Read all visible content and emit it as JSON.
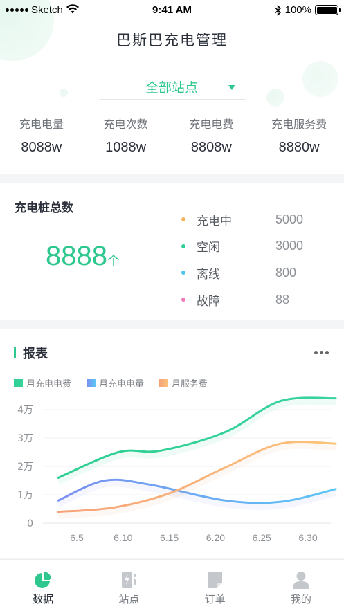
{
  "status_bar": {
    "carrier": "Sketch",
    "time": "9:41 AM",
    "battery": "100%"
  },
  "header": {
    "title": "巴斯巴充电管理",
    "station_selector": "全部站点"
  },
  "stats": [
    {
      "label": "充电电量",
      "value": "8088w"
    },
    {
      "label": "充电次数",
      "value": "1088w"
    },
    {
      "label": "充电电费",
      "value": "8808w"
    },
    {
      "label": "充电服务费",
      "value": "8880w"
    }
  ],
  "total": {
    "title": "充电桩总数",
    "count": "8888",
    "unit": "个",
    "statuses": [
      {
        "name": "充电中",
        "value": "5000",
        "color": "#f7b35c"
      },
      {
        "name": "空闲",
        "value": "3000",
        "color": "#2ecf93"
      },
      {
        "name": "离线",
        "value": "800",
        "color": "#4cc6ef"
      },
      {
        "name": "故障",
        "value": "88",
        "color": "#f07ab8"
      }
    ]
  },
  "report": {
    "title": "报表"
  },
  "chart_data": {
    "type": "line",
    "categories": [
      "6.5",
      "6.10",
      "6.15",
      "6.20",
      "6.25",
      "6.30"
    ],
    "x": [
      0,
      5,
      10,
      15,
      20,
      25
    ],
    "ytick_labels": [
      "0",
      "1万",
      "2万",
      "3万",
      "4万"
    ],
    "ylim": [
      0,
      4
    ],
    "grid": true,
    "legend": "top-left",
    "series": [
      {
        "name": "月充电电费",
        "color": "#2ecf93",
        "color_end": "#38d39d",
        "x": [
          -2,
          4.5,
          9,
          16,
          22,
          28
        ],
        "values": [
          1.6,
          2.5,
          2.55,
          3.2,
          4.3,
          4.4
        ]
      },
      {
        "name": "月充电电量",
        "color": "#7b8ff2",
        "color_end": "#5dc5f5",
        "x": [
          -2,
          3,
          8,
          16,
          22,
          28
        ],
        "values": [
          0.8,
          1.5,
          1.35,
          0.8,
          0.75,
          1.2
        ]
      },
      {
        "name": "月服务费",
        "color": "#f7a27a",
        "color_end": "#fbc47a",
        "x": [
          -2,
          4,
          10,
          16,
          22,
          28
        ],
        "values": [
          0.4,
          0.55,
          1.05,
          1.95,
          2.8,
          2.8
        ]
      }
    ]
  },
  "tabs": [
    {
      "label": "数据",
      "icon": "pie-chart-icon",
      "active": true
    },
    {
      "label": "站点",
      "icon": "charging-station-icon",
      "active": false
    },
    {
      "label": "订单",
      "icon": "document-icon",
      "active": false
    },
    {
      "label": "我的",
      "icon": "user-icon",
      "active": false
    }
  ]
}
